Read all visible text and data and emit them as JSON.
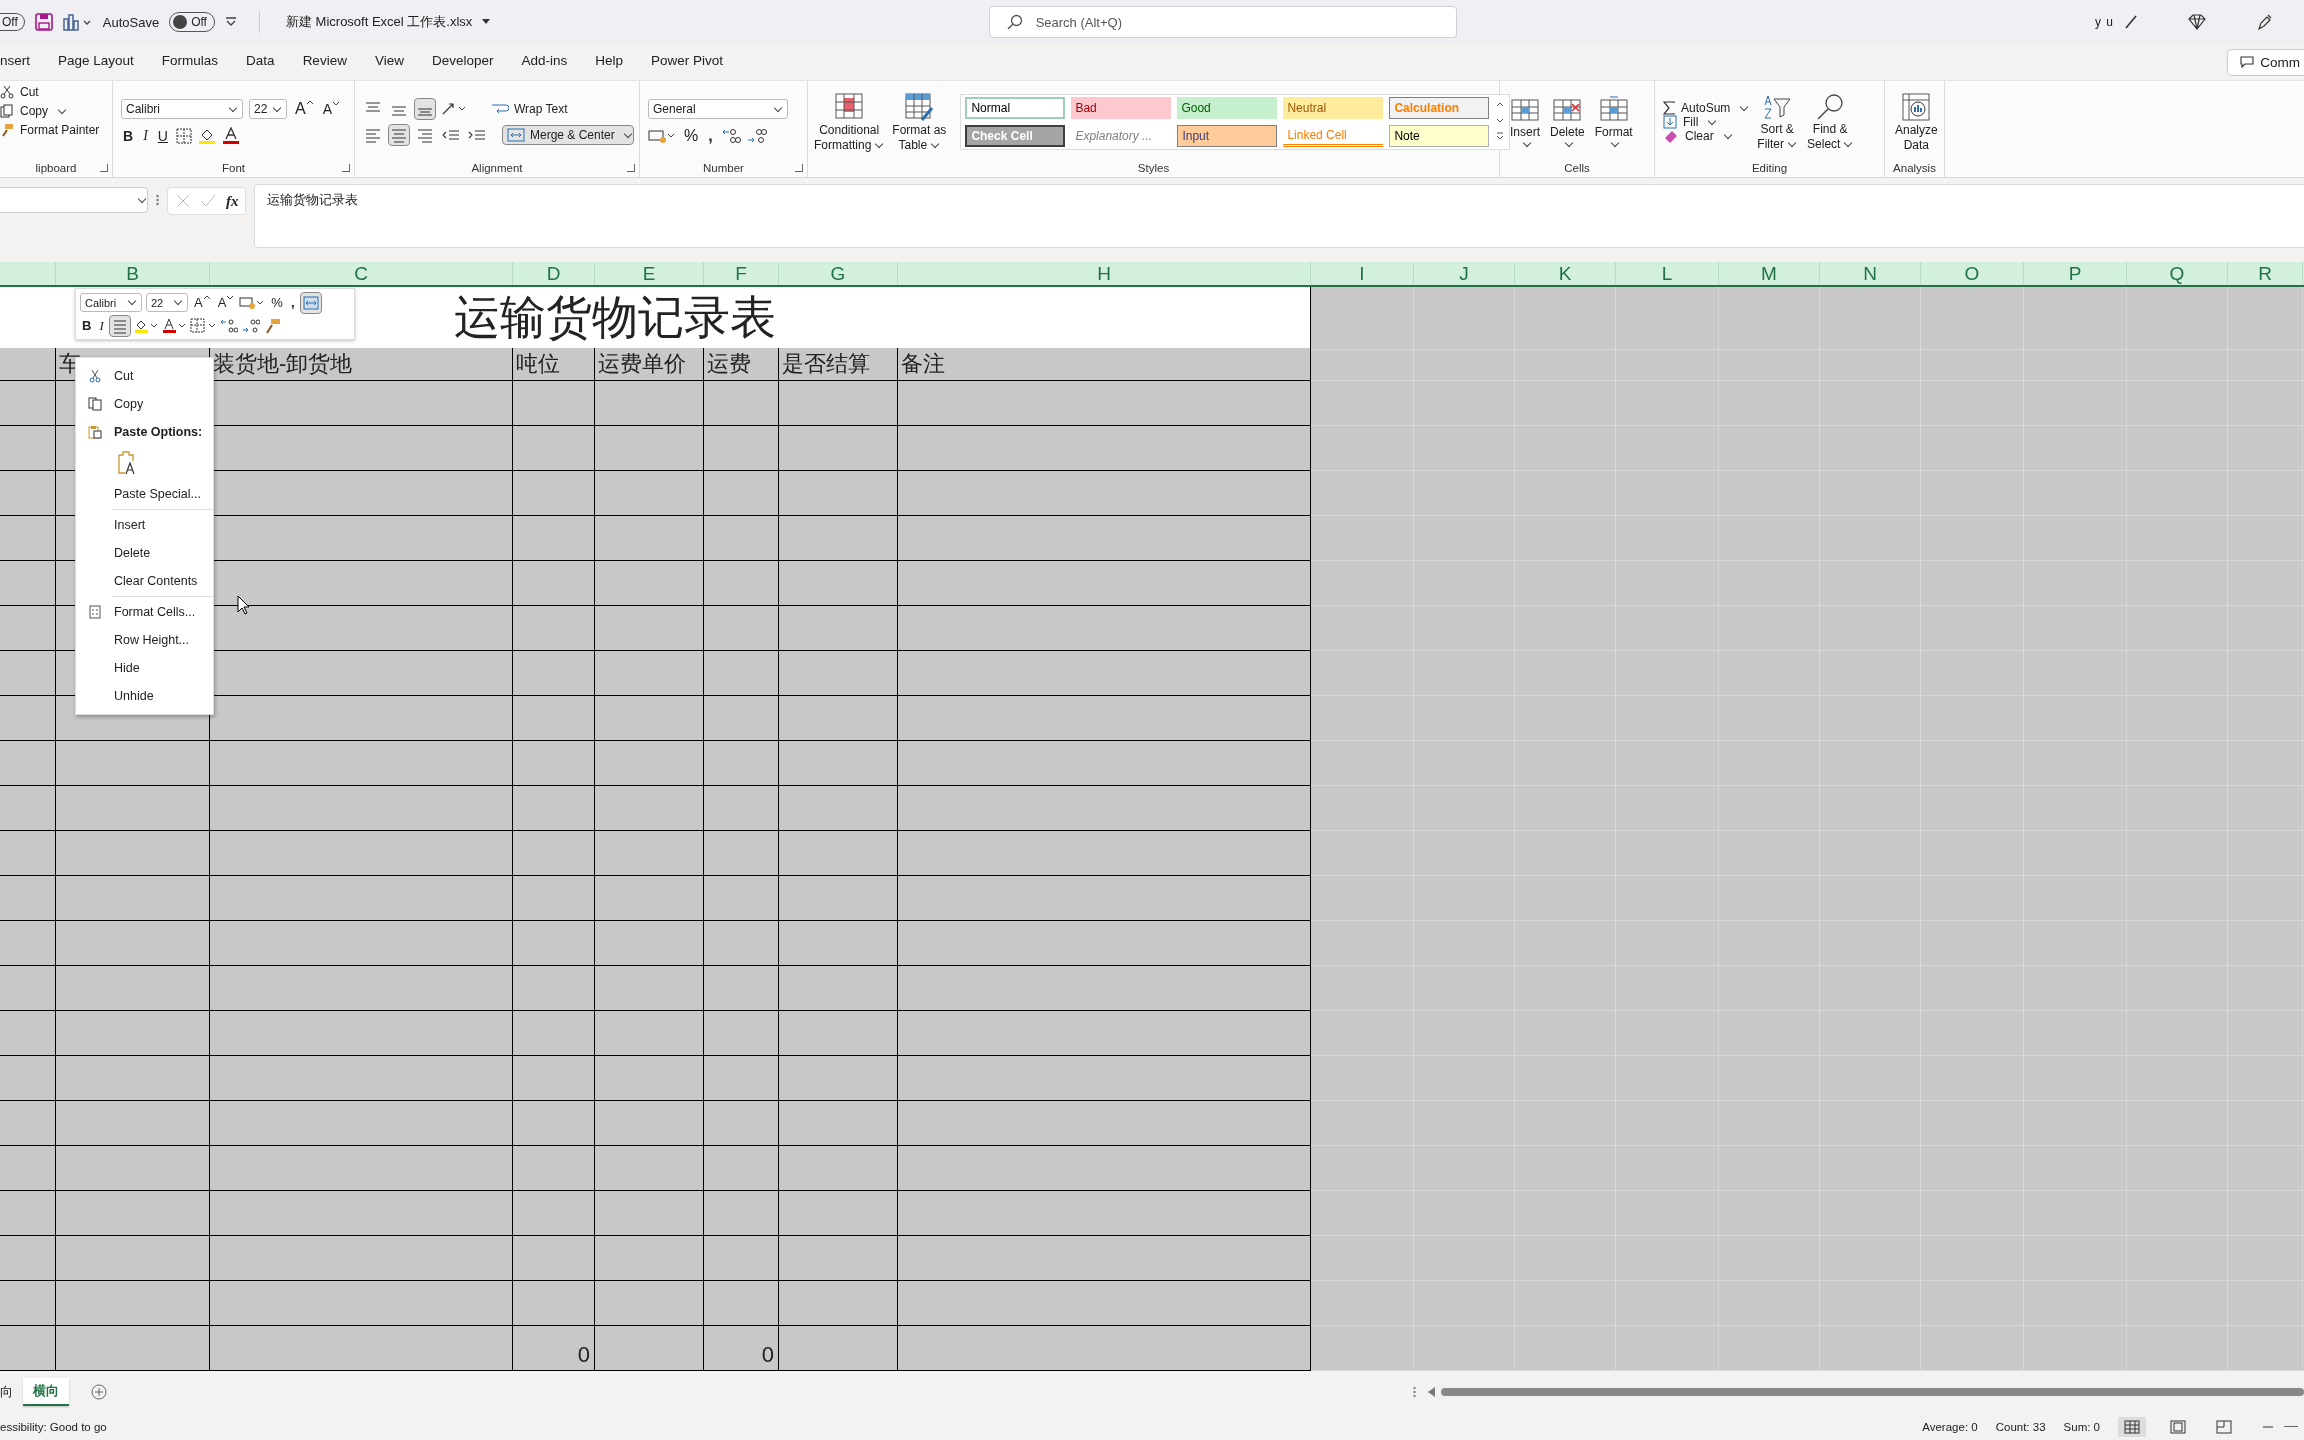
{
  "title_bar": {
    "prev_toggle": "Off",
    "autosave_label": "AutoSave",
    "autosave": {
      "on": false,
      "label": "Off"
    },
    "file_name": "新建 Microsoft Excel 工作表.xlsx",
    "search_placeholder": "Search (Alt+Q)",
    "user_name": "y u"
  },
  "menu_tabs": [
    {
      "label": "nsert",
      "selected": false
    },
    {
      "label": "Page Layout",
      "selected": false
    },
    {
      "label": "Formulas",
      "selected": false
    },
    {
      "label": "Data",
      "selected": false
    },
    {
      "label": "Review",
      "selected": false
    },
    {
      "label": "View",
      "selected": false
    },
    {
      "label": "Developer",
      "selected": false
    },
    {
      "label": "Add-ins",
      "selected": false
    },
    {
      "label": "Help",
      "selected": false
    },
    {
      "label": "Power Pivot",
      "selected": false
    }
  ],
  "comments_button": "Comm",
  "ribbon": {
    "clipboard": {
      "items": [
        "Cut",
        "Copy",
        "Format Painter"
      ],
      "label": "lipboard"
    },
    "font": {
      "name": "Calibri",
      "size": "22",
      "grow": "A",
      "shrink": "A",
      "bold": "B",
      "italic": "I",
      "underline": "U",
      "label": "Font"
    },
    "alignment": {
      "wrap_text": "Wrap Text",
      "merge": "Merge & Center",
      "merge_selected": true,
      "center_selected": true,
      "label": "Alignment"
    },
    "number": {
      "format": "General",
      "percent": "%",
      "comma": ",",
      "label": "Number"
    },
    "styles": {
      "conditional": [
        "Conditional",
        "Formatting"
      ],
      "format_as_table": [
        "Format as",
        "Table"
      ],
      "label": "Styles",
      "cell_styles": [
        {
          "label": "Normal",
          "kind": "normal"
        },
        {
          "label": "Bad",
          "kind": "bad"
        },
        {
          "label": "Good",
          "kind": "good"
        },
        {
          "label": "Neutral",
          "kind": "neutral"
        },
        {
          "label": "Calculation",
          "kind": "calculation"
        },
        {
          "label": "Check Cell",
          "kind": "check"
        },
        {
          "label": "Explanatory ...",
          "kind": "explanatory"
        },
        {
          "label": "Input",
          "kind": "input"
        },
        {
          "label": "Linked Cell",
          "kind": "linked"
        },
        {
          "label": "Note",
          "kind": "note"
        }
      ]
    },
    "cells": {
      "buttons": [
        "Insert",
        "Delete",
        "Format"
      ],
      "label": "Cells"
    },
    "editing": {
      "autosum": "AutoSum",
      "fill": "Fill",
      "clear": "Clear",
      "sort": [
        "Sort &",
        "Filter"
      ],
      "find": [
        "Find &",
        "Select"
      ],
      "label": "Editing"
    },
    "analysis": {
      "button": [
        "Analyze",
        "Data"
      ],
      "label": "Analysis"
    }
  },
  "formula_bar": {
    "function_button": "fx",
    "content": "运输货物记录表"
  },
  "sheet": {
    "columns": [
      "B",
      "C",
      "D",
      "E",
      "F",
      "G",
      "H",
      "I",
      "J",
      "K",
      "L",
      "M",
      "N",
      "O",
      "P",
      "Q",
      "R"
    ],
    "title": "运输货物记录表",
    "headers": [
      "车",
      "装货地-卸货地",
      "吨位",
      "运费单价",
      "运费",
      "是否结算",
      "备注"
    ],
    "total_row": {
      "tonnage": "0",
      "freight": "0"
    }
  },
  "mini_toolbar": {
    "font": "Calibri",
    "size": "22",
    "grow": "A",
    "shrink": "A",
    "percent": "%",
    "comma": ",",
    "bold": "B",
    "italic": "I",
    "center_selected": true
  },
  "context_menu": {
    "items": [
      {
        "label": "Cut",
        "kind": "item"
      },
      {
        "label": "Copy",
        "kind": "item"
      },
      {
        "label": "Paste Options:",
        "kind": "heading"
      },
      {
        "kind": "paste-option"
      },
      {
        "label": "Paste Special...",
        "kind": "item"
      },
      {
        "label": "Insert",
        "kind": "item",
        "separator": true
      },
      {
        "label": "Delete",
        "kind": "item"
      },
      {
        "label": "Clear Contents",
        "kind": "item"
      },
      {
        "label": "Format Cells...",
        "kind": "item",
        "separator": true
      },
      {
        "label": "Row Height...",
        "kind": "item"
      },
      {
        "label": "Hide",
        "kind": "item"
      },
      {
        "label": "Unhide",
        "kind": "item"
      }
    ]
  },
  "sheet_tabs": [
    {
      "label": "向",
      "selected": false
    },
    {
      "label": "横向",
      "selected": true
    }
  ],
  "status_bar": {
    "accessibility": "essibility: Good to go",
    "average": "Average: 0",
    "count": "Count: 33",
    "sum": "Sum: 0"
  }
}
